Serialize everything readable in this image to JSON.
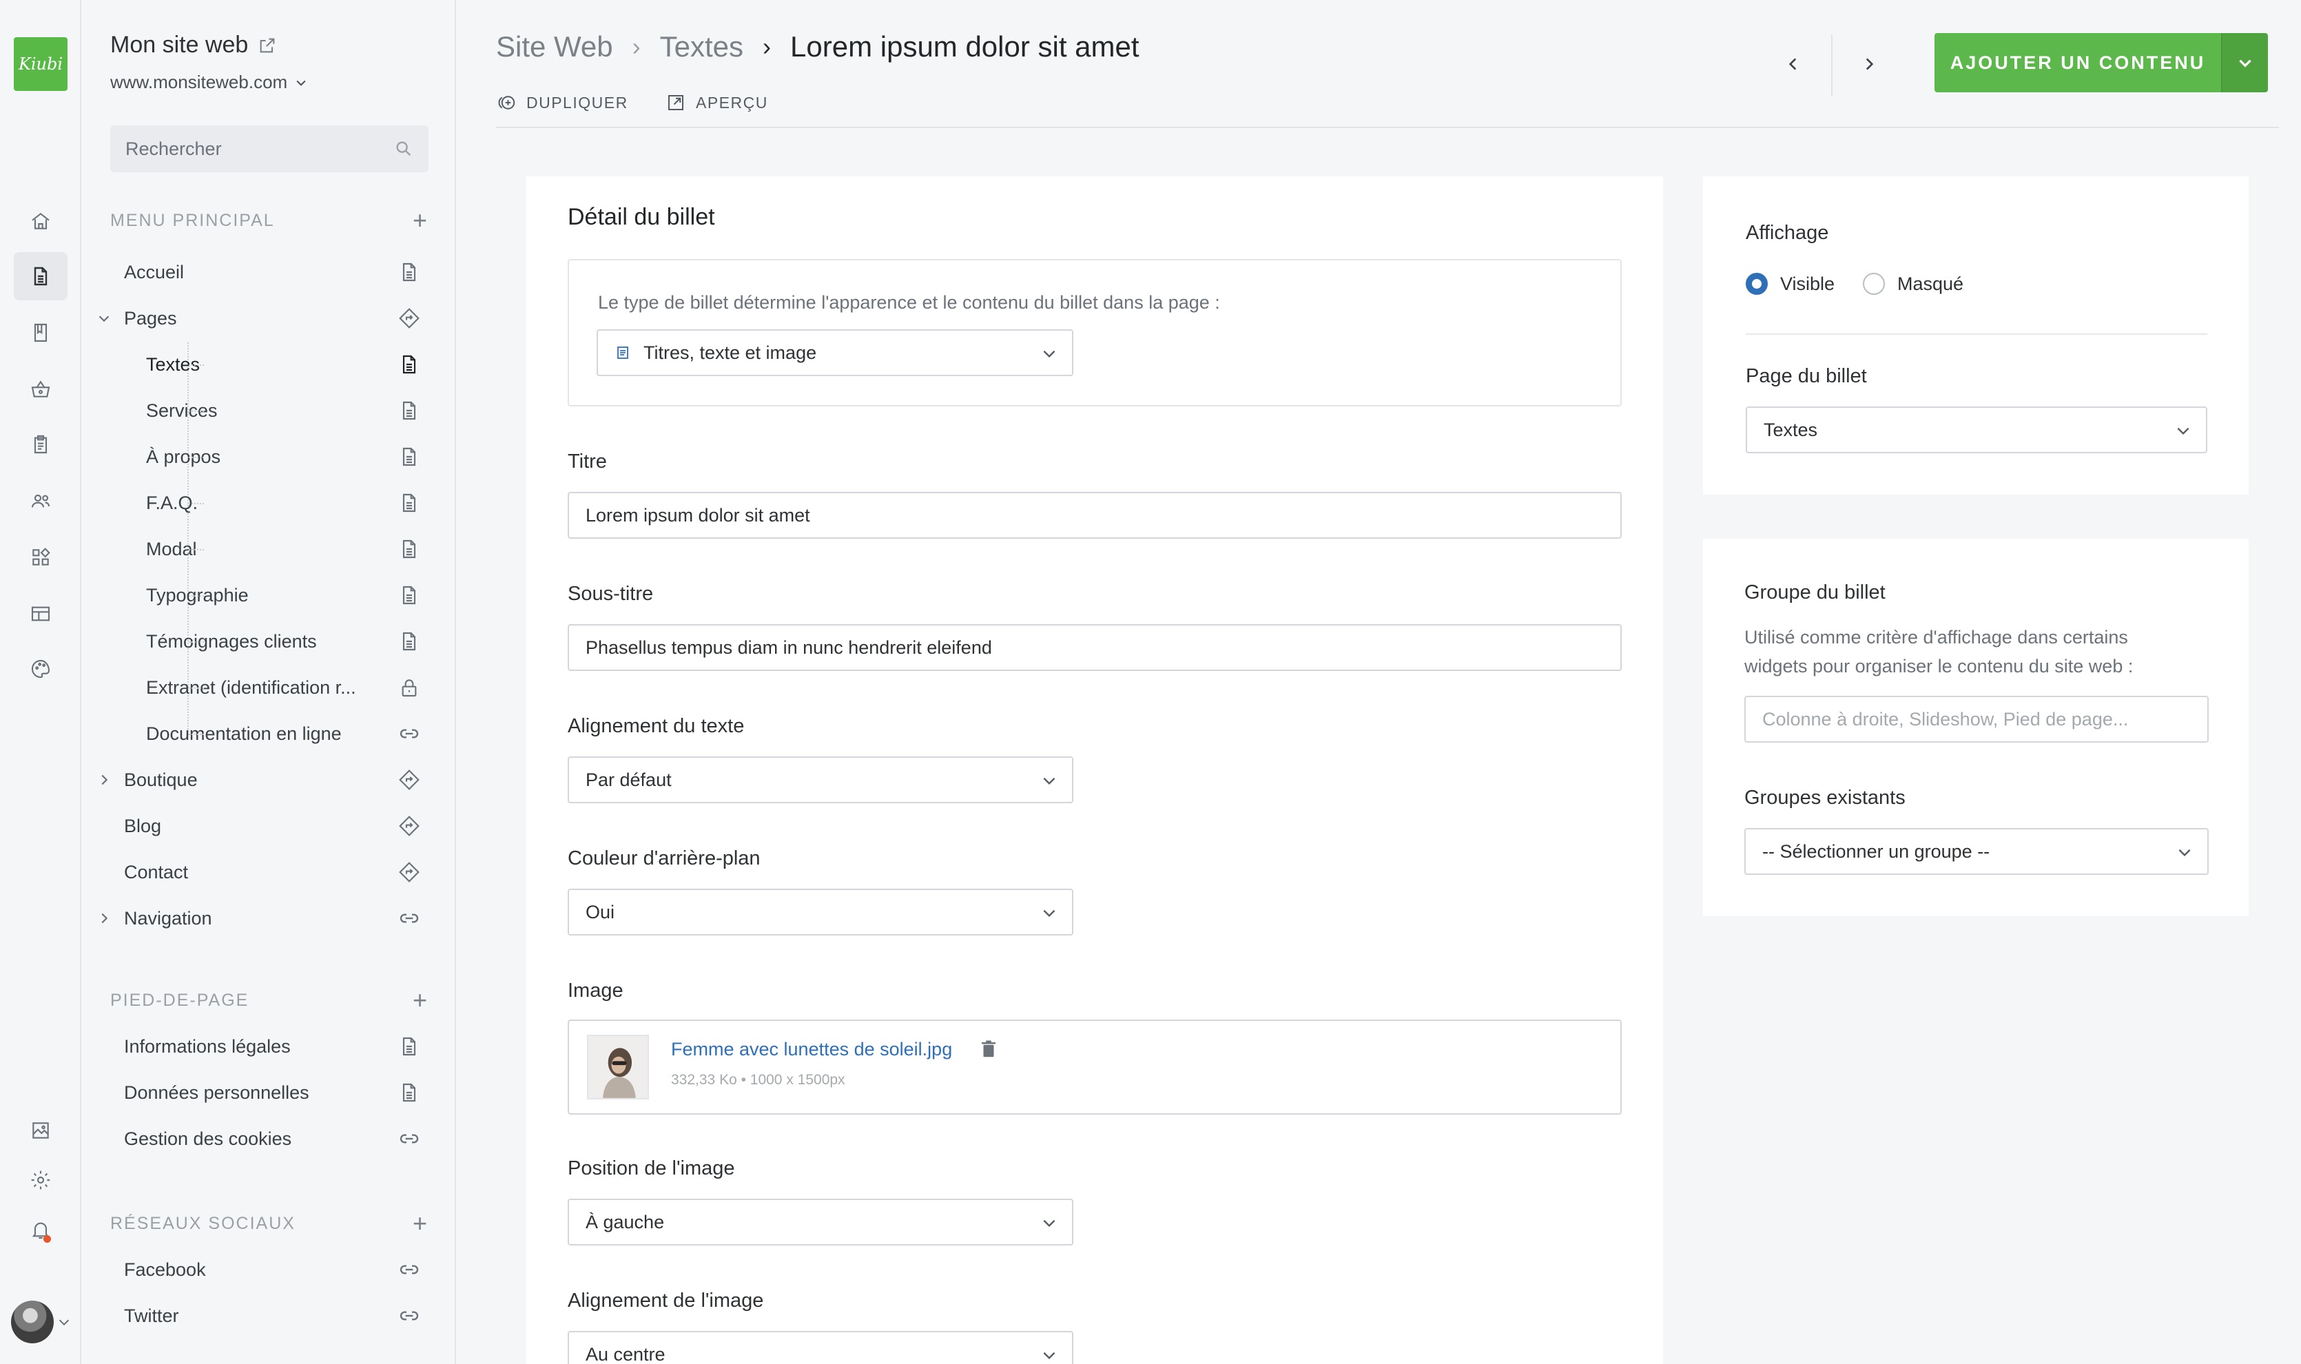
{
  "app": {
    "logo_text": "Kiubi",
    "accent_color": "#5cb84a",
    "link_color": "#2f6fb8"
  },
  "rail": {
    "items": [
      {
        "icon": "home-icon"
      },
      {
        "icon": "document-icon",
        "active": true
      },
      {
        "icon": "book-icon"
      },
      {
        "icon": "basket-icon"
      },
      {
        "icon": "clipboard-icon"
      },
      {
        "icon": "users-icon"
      },
      {
        "icon": "widgets-icon"
      },
      {
        "icon": "layout-icon"
      },
      {
        "icon": "palette-icon"
      },
      {
        "icon": "image-icon"
      },
      {
        "icon": "gear-icon"
      },
      {
        "icon": "bell-icon"
      }
    ]
  },
  "sidebar": {
    "site_name": "Mon site web",
    "site_url": "www.monsiteweb.com",
    "search_placeholder": "Rechercher",
    "main_menu_title": "MENU PRINCIPAL",
    "main_items": [
      {
        "label": "Accueil",
        "icon": "page-icon"
      },
      {
        "label": "Pages",
        "icon": "route-icon",
        "expanded": true
      },
      {
        "label": "Textes",
        "icon": "page-icon",
        "active": true
      },
      {
        "label": "Services",
        "icon": "page-icon"
      },
      {
        "label": "À propos",
        "icon": "page-icon"
      },
      {
        "label": "F.A.Q.",
        "icon": "page-icon"
      },
      {
        "label": "Modal",
        "icon": "page-icon"
      },
      {
        "label": "Typographie",
        "icon": "page-icon"
      },
      {
        "label": "Témoignages clients",
        "icon": "page-icon"
      },
      {
        "label": "Extranet (identification r...",
        "icon": "lock-icon"
      },
      {
        "label": "Documentation en ligne",
        "icon": "link-icon"
      },
      {
        "label": "Boutique",
        "icon": "route-icon",
        "collapsed": true
      },
      {
        "label": "Blog",
        "icon": "route-icon"
      },
      {
        "label": "Contact",
        "icon": "route-icon"
      },
      {
        "label": "Navigation",
        "icon": "link-icon",
        "collapsed": true
      }
    ],
    "footer_title": "PIED-DE-PAGE",
    "footer_items": [
      {
        "label": "Informations légales",
        "icon": "page-icon"
      },
      {
        "label": "Données personnelles",
        "icon": "page-icon"
      },
      {
        "label": "Gestion des cookies",
        "icon": "link-icon"
      }
    ],
    "social_title": "RÉSEAUX SOCIAUX",
    "social_items": [
      {
        "label": "Facebook",
        "icon": "link-icon"
      },
      {
        "label": "Twitter",
        "icon": "link-icon"
      }
    ]
  },
  "header": {
    "breadcrumb": [
      "Site Web",
      "Textes",
      "Lorem ipsum dolor sit amet"
    ],
    "duplicate_label": "DUPLIQUER",
    "preview_label": "APERÇU",
    "add_button_label": "AJOUTER UN CONTENU"
  },
  "detail": {
    "title": "Détail du billet",
    "type_help": "Le type de billet détermine l'apparence et le contenu du billet dans la page :",
    "type_value": "Titres, texte et image",
    "title_label": "Titre",
    "title_value": "Lorem ipsum dolor sit amet",
    "subtitle_label": "Sous-titre",
    "subtitle_value": "Phasellus tempus diam in nunc hendrerit eleifend",
    "text_align_label": "Alignement du texte",
    "text_align_value": "Par défaut",
    "bg_color_label": "Couleur d'arrière-plan",
    "bg_color_value": "Oui",
    "image_label": "Image",
    "image_filename": "Femme avec lunettes de soleil.jpg",
    "image_meta": "332,33 Ko • 1000 x 1500px",
    "image_position_label": "Position de l'image",
    "image_position_value": "À gauche",
    "image_align_label": "Alignement de l'image",
    "image_align_value": "Au centre"
  },
  "display_card": {
    "title": "Affichage",
    "visible_label": "Visible",
    "hidden_label": "Masqué",
    "selected": "Visible",
    "page_label": "Page du billet",
    "page_value": "Textes"
  },
  "group_card": {
    "title": "Groupe du billet",
    "help": "Utilisé comme critère d'affichage dans certains widgets pour organiser le contenu du site web :",
    "input_placeholder": "Colonne à droite, Slideshow, Pied de page...",
    "existing_label": "Groupes existants",
    "existing_value": "-- Sélectionner un groupe --"
  }
}
